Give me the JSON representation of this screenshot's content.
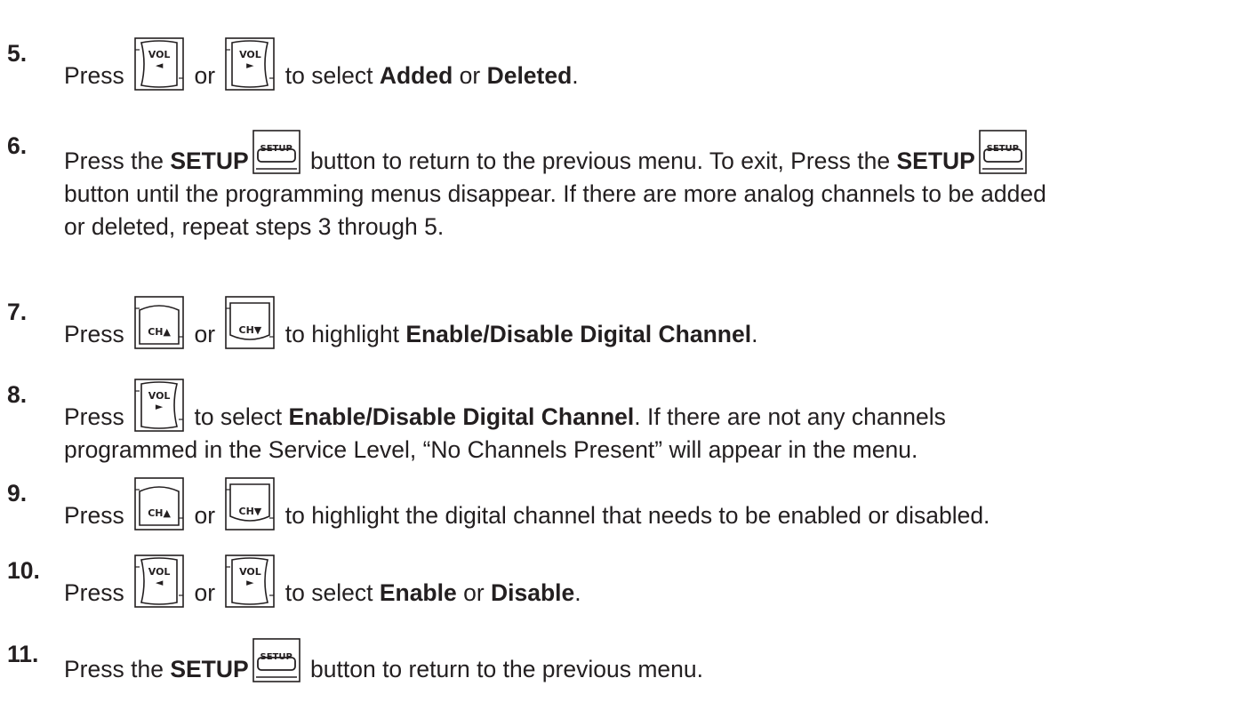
{
  "steps": [
    {
      "number": "5.",
      "lines": [
        [
          {
            "t": "Press "
          },
          {
            "key": "vol-left"
          },
          {
            "t": " or "
          },
          {
            "key": "vol-right"
          },
          {
            "t": " to select "
          },
          {
            "b": "Added"
          },
          {
            "t": " or "
          },
          {
            "b": "Deleted"
          },
          {
            "t": "."
          }
        ]
      ]
    },
    {
      "number": "6.",
      "lines": [
        [
          {
            "t": "Press the "
          },
          {
            "b": "SETUP"
          },
          {
            "key": "setup"
          },
          {
            "t": " button to return to the previous menu. To exit, Press the "
          },
          {
            "b": "SETUP"
          },
          {
            "key": "setup"
          }
        ],
        [
          {
            "t": "button until the programming menus disappear. If there are more analog channels to be added"
          }
        ],
        [
          {
            "t": "or deleted, repeat steps 3 through 5."
          }
        ]
      ]
    },
    {
      "number": "7.",
      "lines": [
        [
          {
            "t": "Press "
          },
          {
            "key": "ch-up"
          },
          {
            "t": " or "
          },
          {
            "key": "ch-down"
          },
          {
            "t": " to highlight "
          },
          {
            "b": "Enable/Disable Digital Channel"
          },
          {
            "t": "."
          }
        ]
      ]
    },
    {
      "number": "8.",
      "lines": [
        [
          {
            "t": "Press "
          },
          {
            "key": "vol-right"
          },
          {
            "t": " to select "
          },
          {
            "b": "Enable/Disable Digital Channel"
          },
          {
            "t": ". If there are not any channels"
          }
        ],
        [
          {
            "t": "programmed in the Service Level, “No Channels Present” will appear in the menu."
          }
        ]
      ]
    },
    {
      "number": "9.",
      "lines": [
        [
          {
            "t": "Press "
          },
          {
            "key": "ch-up"
          },
          {
            "t": " or "
          },
          {
            "key": "ch-down"
          },
          {
            "t": " to highlight the digital channel that needs to be enabled or disabled."
          }
        ]
      ]
    },
    {
      "number": "10.",
      "lines": [
        [
          {
            "t": "Press "
          },
          {
            "key": "vol-left"
          },
          {
            "t": " or "
          },
          {
            "key": "vol-right"
          },
          {
            "t": " to select "
          },
          {
            "b": "Enable"
          },
          {
            "t": " or "
          },
          {
            "b": "Disable"
          },
          {
            "t": "."
          }
        ]
      ]
    },
    {
      "number": "11.",
      "lines": [
        [
          {
            "t": "Press the "
          },
          {
            "b": "SETUP"
          },
          {
            "key": "setup"
          },
          {
            "t": " button to return to the previous menu."
          }
        ]
      ]
    }
  ],
  "keys": {
    "vol-left": {
      "label": "VOL",
      "arrow": "◄",
      "icon": "volume-left-key-icon"
    },
    "vol-right": {
      "label": "VOL",
      "arrow": "►",
      "icon": "volume-right-key-icon"
    },
    "ch-up": {
      "label": "CH▲",
      "icon": "channel-up-key-icon"
    },
    "ch-down": {
      "label": "CH▼",
      "icon": "channel-down-key-icon"
    },
    "setup": {
      "label": "SETUP",
      "icon": "setup-key-icon"
    }
  },
  "colors": {
    "text": "#231f20",
    "background": "#ffffff"
  }
}
